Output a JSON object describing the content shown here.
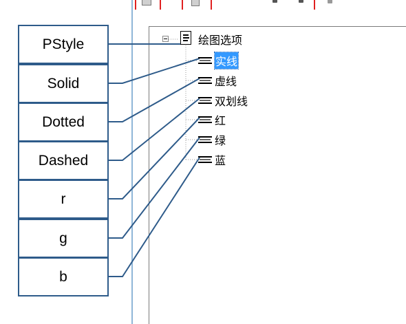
{
  "boxes": [
    {
      "label": "PStyle"
    },
    {
      "label": "Solid"
    },
    {
      "label": "Dotted"
    },
    {
      "label": "Dashed"
    },
    {
      "label": "r"
    },
    {
      "label": "g"
    },
    {
      "label": "b"
    }
  ],
  "tree": {
    "root_label": "绘图选项",
    "children": [
      {
        "label": "实线",
        "selected": true
      },
      {
        "label": "虚线"
      },
      {
        "label": "双划线"
      },
      {
        "label": "红"
      },
      {
        "label": "绿"
      },
      {
        "label": "蓝"
      }
    ]
  },
  "colors": {
    "connector": "#2e5b8a",
    "highlight": "#3399ff",
    "toolbar_outline": "#e02020"
  }
}
